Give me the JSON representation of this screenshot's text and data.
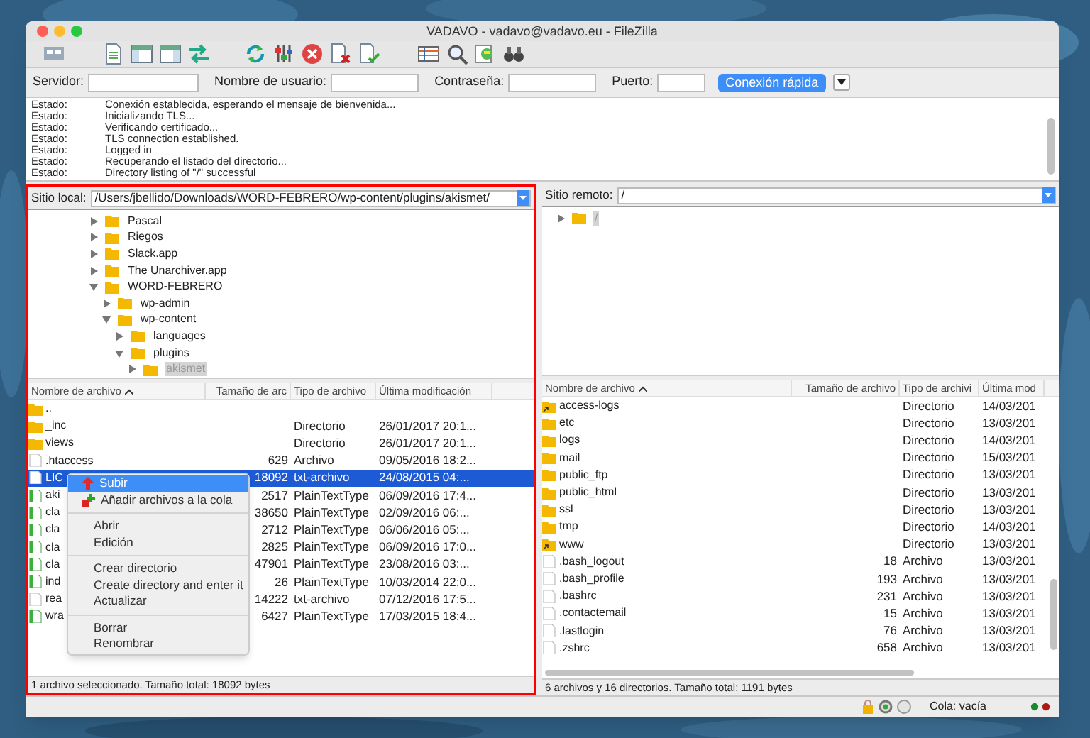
{
  "window": {
    "title": "VADAVO - vadavo@vadavo.eu - FileZilla"
  },
  "quickconnect": {
    "fields": [
      {
        "label": "Servidor:"
      },
      {
        "label": "Nombre de usuario:"
      },
      {
        "label": "Contraseña:"
      },
      {
        "label": "Puerto:"
      }
    ],
    "button": "Conexión rápida"
  },
  "log": [
    {
      "kind": "Estado:",
      "message": "Conexión establecida, esperando el mensaje de bienvenida..."
    },
    {
      "kind": "Estado:",
      "message": "Inicializando TLS..."
    },
    {
      "kind": "Estado:",
      "message": "Verificando certificado..."
    },
    {
      "kind": "Estado:",
      "message": "TLS connection established."
    },
    {
      "kind": "Estado:",
      "message": "Logged in"
    },
    {
      "kind": "Estado:",
      "message": "Recuperando el listado del directorio..."
    },
    {
      "kind": "Estado:",
      "message": "Directory listing of \"/\" successful"
    }
  ],
  "local": {
    "site_label": "Sitio local:",
    "path": "/Users/jbellido/Downloads/WORD-FEBRERO/wp-content/plugins/akismet/",
    "tree": [
      {
        "label": "Pascal",
        "expanded": false,
        "selected": false
      },
      {
        "label": "Riegos",
        "expanded": false,
        "selected": false
      },
      {
        "label": "Slack.app",
        "expanded": false,
        "selected": false
      },
      {
        "label": "The Unarchiver.app",
        "expanded": false,
        "selected": false
      },
      {
        "label": "WORD-FEBRERO",
        "expanded": true,
        "selected": false,
        "children": [
          {
            "label": "wp-admin",
            "expanded": false,
            "selected": false
          },
          {
            "label": "wp-content",
            "expanded": true,
            "selected": false,
            "children": [
              {
                "label": "languages",
                "expanded": false,
                "selected": false
              },
              {
                "label": "plugins",
                "expanded": true,
                "selected": false,
                "children": [
                  {
                    "label": "akismet",
                    "expanded": false,
                    "selected": true
                  }
                ]
              }
            ]
          }
        ]
      }
    ],
    "columns": [
      "Nombre de archivo",
      "Tamaño de arc",
      "Tipo de archivo",
      "Última modificación"
    ],
    "rows": [
      {
        "kind": "folder",
        "name": "..",
        "size": "",
        "type": "",
        "modified": "",
        "selected": false
      },
      {
        "kind": "folder",
        "name": "_inc",
        "size": "",
        "type": "Directorio",
        "modified": "26/01/2017 20:1...",
        "selected": false
      },
      {
        "kind": "folder",
        "name": "views",
        "size": "",
        "type": "Directorio",
        "modified": "26/01/2017 20:1...",
        "selected": false
      },
      {
        "kind": "file",
        "name": ".htaccess",
        "size": "629",
        "type": "Archivo",
        "modified": "09/05/2016 18:2...",
        "selected": false
      },
      {
        "kind": "file",
        "name": "LIC",
        "size": "18092",
        "type": "txt-archivo",
        "modified": "24/08/2015 04:...",
        "selected": true
      },
      {
        "kind": "text",
        "name": "aki",
        "size": "2517",
        "type": "PlainTextType",
        "modified": "06/09/2016 17:4...",
        "selected": false
      },
      {
        "kind": "text",
        "name": "cla",
        "size": "38650",
        "type": "PlainTextType",
        "modified": "02/09/2016 06:...",
        "selected": false
      },
      {
        "kind": "text",
        "name": "cla",
        "size": "2712",
        "type": "PlainTextType",
        "modified": "06/06/2016 05:...",
        "selected": false
      },
      {
        "kind": "text",
        "name": "cla",
        "size": "2825",
        "type": "PlainTextType",
        "modified": "06/09/2016 17:0...",
        "selected": false
      },
      {
        "kind": "text",
        "name": "cla",
        "size": "47901",
        "type": "PlainTextType",
        "modified": "23/08/2016 03:...",
        "selected": false
      },
      {
        "kind": "text",
        "name": "ind",
        "size": "26",
        "type": "PlainTextType",
        "modified": "10/03/2014 22:0...",
        "selected": false
      },
      {
        "kind": "file",
        "name": "rea",
        "size": "14222",
        "type": "txt-archivo",
        "modified": "07/12/2016 17:5...",
        "selected": false
      },
      {
        "kind": "text",
        "name": "wra",
        "size": "6427",
        "type": "PlainTextType",
        "modified": "17/03/2015 18:4...",
        "selected": false
      }
    ],
    "status": "1 archivo seleccionado. Tamaño total: 18092 bytes"
  },
  "context_menu": [
    {
      "kind": "item",
      "label": "Subir",
      "selected": true
    },
    {
      "kind": "item",
      "label": "Añadir archivos a la cola",
      "selected": false
    },
    {
      "kind": "separator"
    },
    {
      "kind": "item",
      "label": "Abrir",
      "selected": false
    },
    {
      "kind": "item",
      "label": "Edición",
      "selected": false
    },
    {
      "kind": "separator"
    },
    {
      "kind": "item",
      "label": "Crear directorio",
      "selected": false
    },
    {
      "kind": "item",
      "label": "Create directory and enter it",
      "selected": false
    },
    {
      "kind": "item",
      "label": "Actualizar",
      "selected": false
    },
    {
      "kind": "separator"
    },
    {
      "kind": "item",
      "label": "Borrar",
      "selected": false
    },
    {
      "kind": "item",
      "label": "Renombrar",
      "selected": false
    }
  ],
  "remote": {
    "site_label": "Sitio remoto:",
    "path": "/",
    "tree": [
      {
        "label": "/",
        "expanded": false,
        "selected": true
      }
    ],
    "columns": [
      "Nombre de archivo",
      "Tamaño de archivo",
      "Tipo de archivi",
      "Última mod"
    ],
    "rows": [
      {
        "kind": "link",
        "name": "access-logs",
        "size": "",
        "type": "Directorio",
        "modified": "14/03/201"
      },
      {
        "kind": "folder",
        "name": "etc",
        "size": "",
        "type": "Directorio",
        "modified": "13/03/201"
      },
      {
        "kind": "folder",
        "name": "logs",
        "size": "",
        "type": "Directorio",
        "modified": "14/03/201"
      },
      {
        "kind": "folder",
        "name": "mail",
        "size": "",
        "type": "Directorio",
        "modified": "15/03/201"
      },
      {
        "kind": "folder",
        "name": "public_ftp",
        "size": "",
        "type": "Directorio",
        "modified": "13/03/201"
      },
      {
        "kind": "folder",
        "name": "public_html",
        "size": "",
        "type": "Directorio",
        "modified": "13/03/201"
      },
      {
        "kind": "folder",
        "name": "ssl",
        "size": "",
        "type": "Directorio",
        "modified": "13/03/201"
      },
      {
        "kind": "folder",
        "name": "tmp",
        "size": "",
        "type": "Directorio",
        "modified": "14/03/201"
      },
      {
        "kind": "link",
        "name": "www",
        "size": "",
        "type": "Directorio",
        "modified": "13/03/201"
      },
      {
        "kind": "file",
        "name": ".bash_logout",
        "size": "18",
        "type": "Archivo",
        "modified": "13/03/201"
      },
      {
        "kind": "file",
        "name": ".bash_profile",
        "size": "193",
        "type": "Archivo",
        "modified": "13/03/201"
      },
      {
        "kind": "file",
        "name": ".bashrc",
        "size": "231",
        "type": "Archivo",
        "modified": "13/03/201"
      },
      {
        "kind": "file",
        "name": ".contactemail",
        "size": "15",
        "type": "Archivo",
        "modified": "13/03/201"
      },
      {
        "kind": "file",
        "name": ".lastlogin",
        "size": "76",
        "type": "Archivo",
        "modified": "13/03/201"
      },
      {
        "kind": "file",
        "name": ".zshrc",
        "size": "658",
        "type": "Archivo",
        "modified": "13/03/201"
      }
    ],
    "status": "6 archivos y 16 directorios. Tamaño total: 1191 bytes"
  },
  "statusbar": {
    "queue": "Cola: vacía"
  }
}
